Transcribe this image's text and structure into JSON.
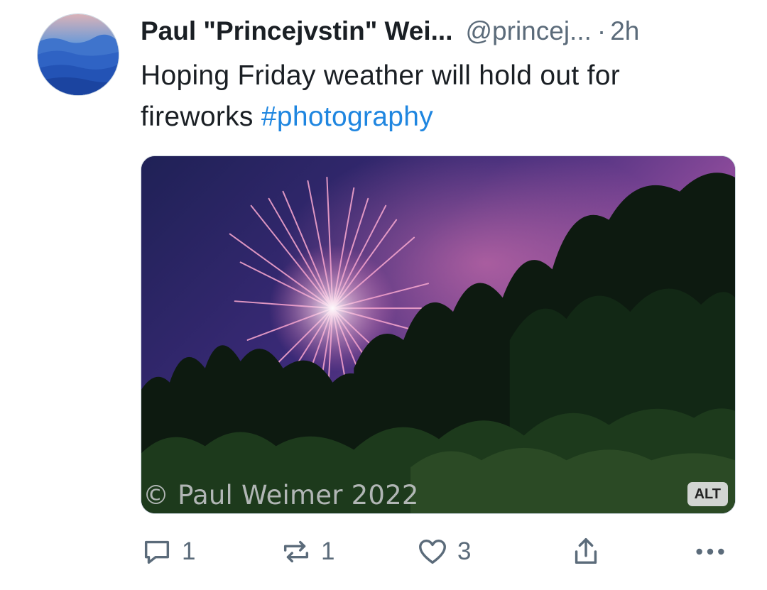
{
  "post": {
    "author": {
      "display_name": "Paul \"Princejvstin\" Wei...",
      "handle": "@princej...",
      "avatar_icon": "mountain-landscape-avatar"
    },
    "separator": "·",
    "time": "2h",
    "text": "Hoping Friday weather will hold out for fireworks ",
    "hashtag": "#photography",
    "media": {
      "watermark": "© Paul Weimer 2022",
      "alt_label": "ALT"
    },
    "actions": {
      "reply_count": "1",
      "repost_count": "1",
      "like_count": "3",
      "reply_icon": "comment-icon",
      "repost_icon": "repost-icon",
      "like_icon": "heart-icon",
      "share_icon": "share-icon",
      "more_icon": "more-options-icon"
    }
  },
  "colors": {
    "text": "#1a1f24",
    "muted": "#5b6b7a",
    "link": "#1f86e0"
  }
}
